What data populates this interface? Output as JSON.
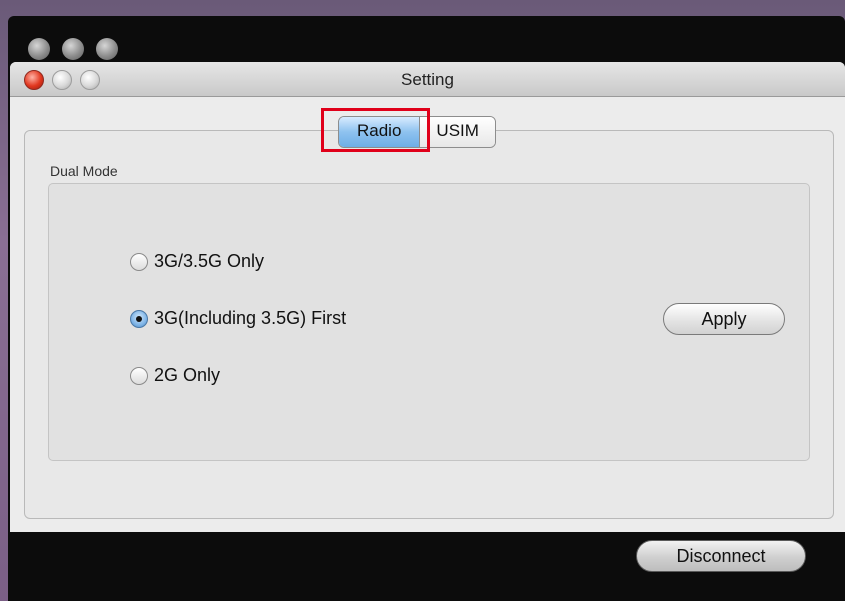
{
  "dialog": {
    "title": "Setting"
  },
  "tabs": [
    {
      "label": "Radio",
      "active": true
    },
    {
      "label": "USIM",
      "active": false
    }
  ],
  "dual_mode": {
    "label": "Dual Mode",
    "options": [
      {
        "label": "3G/3.5G Only",
        "checked": false
      },
      {
        "label": "3G(Including 3.5G) First",
        "checked": true
      },
      {
        "label": "2G Only",
        "checked": false
      }
    ],
    "apply_label": "Apply"
  },
  "footer": {
    "disconnect_label": "Disconnect"
  },
  "colors": {
    "highlight": "#e0001a",
    "active_tab": "#8ec2ef",
    "close_button": "#e1371f"
  }
}
